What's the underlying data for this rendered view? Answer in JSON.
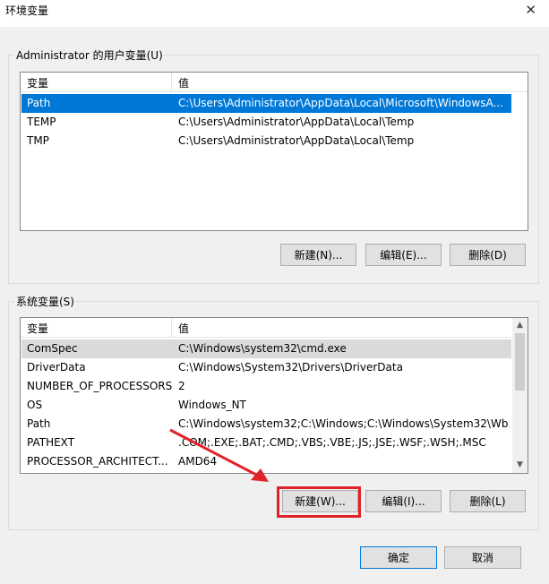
{
  "window": {
    "title": "环境变量"
  },
  "user_group": {
    "legend": "Administrator 的用户变量(U)",
    "headers": {
      "name": "变量",
      "value": "值"
    },
    "rows": [
      {
        "name": "Path",
        "value": "C:\\Users\\Administrator\\AppData\\Local\\Microsoft\\WindowsA...",
        "selected": true
      },
      {
        "name": "TEMP",
        "value": "C:\\Users\\Administrator\\AppData\\Local\\Temp"
      },
      {
        "name": "TMP",
        "value": "C:\\Users\\Administrator\\AppData\\Local\\Temp"
      }
    ],
    "buttons": {
      "new": "新建(N)...",
      "edit": "编辑(E)...",
      "delete": "删除(D)"
    }
  },
  "system_group": {
    "legend": "系统变量(S)",
    "headers": {
      "name": "变量",
      "value": "值"
    },
    "rows": [
      {
        "name": "ComSpec",
        "value": "C:\\Windows\\system32\\cmd.exe",
        "highlighted": true
      },
      {
        "name": "DriverData",
        "value": "C:\\Windows\\System32\\Drivers\\DriverData"
      },
      {
        "name": "NUMBER_OF_PROCESSORS",
        "value": "2"
      },
      {
        "name": "OS",
        "value": "Windows_NT"
      },
      {
        "name": "Path",
        "value": "C:\\Windows\\system32;C:\\Windows;C:\\Windows\\System32\\Wb..."
      },
      {
        "name": "PATHEXT",
        "value": ".COM;.EXE;.BAT;.CMD;.VBS;.VBE;.JS;.JSE;.WSF;.WSH;.MSC"
      },
      {
        "name": "PROCESSOR_ARCHITECT...",
        "value": "AMD64"
      }
    ],
    "buttons": {
      "new": "新建(W)...",
      "edit": "编辑(I)...",
      "delete": "删除(L)"
    }
  },
  "footer": {
    "ok": "确定",
    "cancel": "取消"
  },
  "colors": {
    "selection": "#0078d7",
    "annotation": "#e0232a"
  },
  "icons": {
    "close": "close-icon",
    "scroll_up": "chevron-up-icon",
    "scroll_down": "chevron-down-icon",
    "annotation": "red-arrow-annotation"
  }
}
